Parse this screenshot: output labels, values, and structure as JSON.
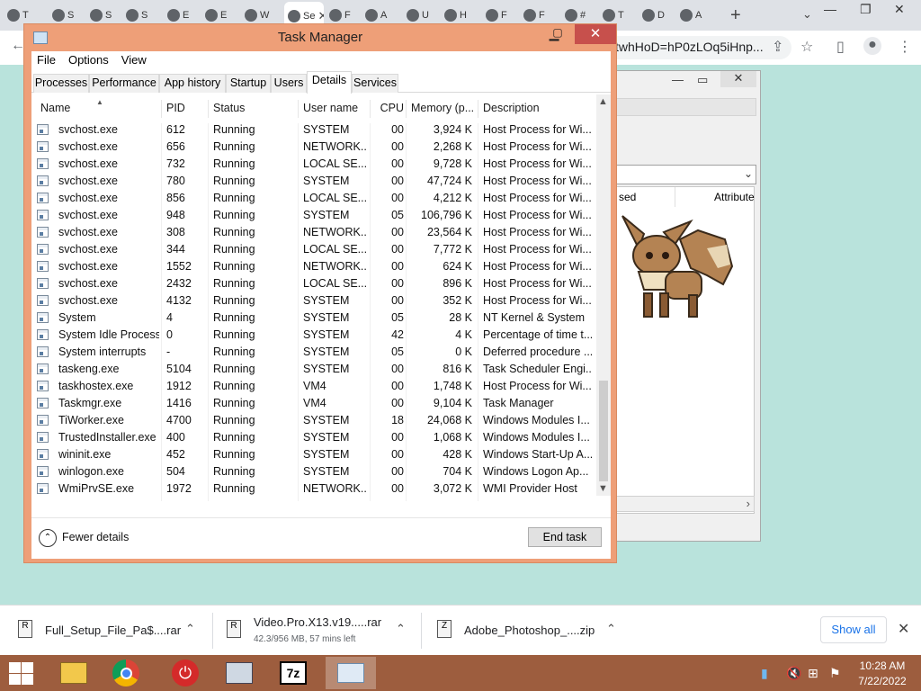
{
  "browser": {
    "tabs": [
      {
        "label": "T"
      },
      {
        "label": "S"
      },
      {
        "label": "S"
      },
      {
        "label": "S"
      },
      {
        "label": "E"
      },
      {
        "label": "E"
      },
      {
        "label": "W"
      },
      {
        "label": "Se"
      },
      {
        "label": "F"
      },
      {
        "label": "A"
      },
      {
        "label": "U"
      },
      {
        "label": "H"
      },
      {
        "label": "F"
      },
      {
        "label": "F"
      },
      {
        "label": "#"
      },
      {
        "label": "T"
      },
      {
        "label": "D"
      },
      {
        "label": "A"
      }
    ],
    "address_fragment": "twhHoD=hP0zLOq5iHnp...",
    "new_tab_glyph": "+",
    "dropdown_glyph": "⌄"
  },
  "bg_window": {
    "col_used": "sed",
    "col_attributes": "Attribute"
  },
  "task_manager": {
    "title": "Task Manager",
    "menu": [
      "File",
      "Options",
      "View"
    ],
    "tabs": [
      "Processes",
      "Performance",
      "App history",
      "Startup",
      "Users",
      "Details",
      "Services"
    ],
    "active_tab": "Details",
    "columns": [
      "Name",
      "PID",
      "Status",
      "User name",
      "CPU",
      "Memory (p...",
      "Description"
    ],
    "rows": [
      {
        "name": "svchost.exe",
        "pid": "612",
        "status": "Running",
        "user": "SYSTEM",
        "cpu": "00",
        "mem": "3,924 K",
        "desc": "Host Process for Wi..."
      },
      {
        "name": "svchost.exe",
        "pid": "656",
        "status": "Running",
        "user": "NETWORK...",
        "cpu": "00",
        "mem": "2,268 K",
        "desc": "Host Process for Wi..."
      },
      {
        "name": "svchost.exe",
        "pid": "732",
        "status": "Running",
        "user": "LOCAL SE...",
        "cpu": "00",
        "mem": "9,728 K",
        "desc": "Host Process for Wi..."
      },
      {
        "name": "svchost.exe",
        "pid": "780",
        "status": "Running",
        "user": "SYSTEM",
        "cpu": "00",
        "mem": "47,724 K",
        "desc": "Host Process for Wi..."
      },
      {
        "name": "svchost.exe",
        "pid": "856",
        "status": "Running",
        "user": "LOCAL SE...",
        "cpu": "00",
        "mem": "4,212 K",
        "desc": "Host Process for Wi..."
      },
      {
        "name": "svchost.exe",
        "pid": "948",
        "status": "Running",
        "user": "SYSTEM",
        "cpu": "05",
        "mem": "106,796 K",
        "desc": "Host Process for Wi..."
      },
      {
        "name": "svchost.exe",
        "pid": "308",
        "status": "Running",
        "user": "NETWORK...",
        "cpu": "00",
        "mem": "23,564 K",
        "desc": "Host Process for Wi..."
      },
      {
        "name": "svchost.exe",
        "pid": "344",
        "status": "Running",
        "user": "LOCAL SE...",
        "cpu": "00",
        "mem": "7,772 K",
        "desc": "Host Process for Wi..."
      },
      {
        "name": "svchost.exe",
        "pid": "1552",
        "status": "Running",
        "user": "NETWORK...",
        "cpu": "00",
        "mem": "624 K",
        "desc": "Host Process for Wi..."
      },
      {
        "name": "svchost.exe",
        "pid": "2432",
        "status": "Running",
        "user": "LOCAL SE...",
        "cpu": "00",
        "mem": "896 K",
        "desc": "Host Process for Wi..."
      },
      {
        "name": "svchost.exe",
        "pid": "4132",
        "status": "Running",
        "user": "SYSTEM",
        "cpu": "00",
        "mem": "352 K",
        "desc": "Host Process for Wi..."
      },
      {
        "name": "System",
        "pid": "4",
        "status": "Running",
        "user": "SYSTEM",
        "cpu": "05",
        "mem": "28 K",
        "desc": "NT Kernel & System"
      },
      {
        "name": "System Idle Process",
        "pid": "0",
        "status": "Running",
        "user": "SYSTEM",
        "cpu": "42",
        "mem": "4 K",
        "desc": "Percentage of time t..."
      },
      {
        "name": "System interrupts",
        "pid": "-",
        "status": "Running",
        "user": "SYSTEM",
        "cpu": "05",
        "mem": "0 K",
        "desc": "Deferred procedure ..."
      },
      {
        "name": "taskeng.exe",
        "pid": "5104",
        "status": "Running",
        "user": "SYSTEM",
        "cpu": "00",
        "mem": "816 K",
        "desc": "Task Scheduler Engi..."
      },
      {
        "name": "taskhostex.exe",
        "pid": "1912",
        "status": "Running",
        "user": "VM4",
        "cpu": "00",
        "mem": "1,748 K",
        "desc": "Host Process for Wi..."
      },
      {
        "name": "Taskmgr.exe",
        "pid": "1416",
        "status": "Running",
        "user": "VM4",
        "cpu": "00",
        "mem": "9,104 K",
        "desc": "Task Manager"
      },
      {
        "name": "TiWorker.exe",
        "pid": "4700",
        "status": "Running",
        "user": "SYSTEM",
        "cpu": "18",
        "mem": "24,068 K",
        "desc": "Windows Modules I..."
      },
      {
        "name": "TrustedInstaller.exe",
        "pid": "400",
        "status": "Running",
        "user": "SYSTEM",
        "cpu": "00",
        "mem": "1,068 K",
        "desc": "Windows Modules I..."
      },
      {
        "name": "wininit.exe",
        "pid": "452",
        "status": "Running",
        "user": "SYSTEM",
        "cpu": "00",
        "mem": "428 K",
        "desc": "Windows Start-Up A..."
      },
      {
        "name": "winlogon.exe",
        "pid": "504",
        "status": "Running",
        "user": "SYSTEM",
        "cpu": "00",
        "mem": "704 K",
        "desc": "Windows Logon Ap..."
      },
      {
        "name": "WmiPrvSE.exe",
        "pid": "1972",
        "status": "Running",
        "user": "NETWORK...",
        "cpu": "00",
        "mem": "3,072 K",
        "desc": "WMI Provider Host"
      }
    ],
    "fewer_details": "Fewer details",
    "end_task": "End task"
  },
  "downloads": {
    "items": [
      {
        "name": "Full_Setup_File_Pa$....rar",
        "sub": ""
      },
      {
        "name": "Video.Pro.X13.v19.....rar",
        "sub": "42.3/956 MB, 57 mins left"
      },
      {
        "name": "Adobe_Photoshop_....zip",
        "sub": ""
      }
    ],
    "show_all": "Show all"
  },
  "taskbar": {
    "time": "10:28 AM",
    "date": "7/22/2022"
  },
  "colors": {
    "taskbar": "#9d5d3e",
    "tm_frame": "#ee9f78",
    "tm_close": "#c7504c",
    "desktop": "#b9e3dc",
    "link_blue": "#1a73e8"
  }
}
